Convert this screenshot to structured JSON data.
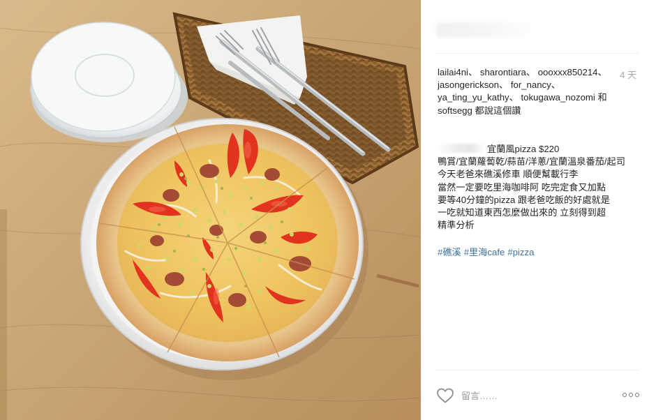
{
  "post": {
    "time_ago": "4 天",
    "likes": {
      "users": [
        "lailai4ni",
        "sharontiara",
        "oooxxx850214",
        "jasongerickson",
        "for_nancy",
        "ya_ting_yu_kathy",
        "tokugawa_nozomi"
      ],
      "last_user": "softsegg",
      "separator": "、",
      "connector": "和",
      "suffix": "都說這個讚"
    },
    "caption": {
      "lines": [
        "宜蘭風pizza $220",
        "鴨賞/宜蘭蘿蔔乾/蒜苗/洋蔥/宜蘭溫泉番茄/起司",
        "今天老爸來礁溪修車 順便幫載行李",
        "當然一定要吃里海咖啡阿 吃完定食又加點",
        "要等40分鐘的pizza 跟老爸吃飯的好處就是",
        "一吃就知道東西怎麼做出來的 立刻得到超",
        "精準分析"
      ],
      "hashtags": [
        "#礁溪",
        "#里海cafe",
        "#pizza"
      ]
    },
    "comment": {
      "placeholder": "留言……"
    },
    "icons": {
      "like": "heart-icon",
      "more": "more-options-icon"
    }
  },
  "colors": {
    "text": "#262626",
    "muted": "#a5a7aa",
    "hashtag": "#3f729b",
    "divider": "#efefef"
  }
}
